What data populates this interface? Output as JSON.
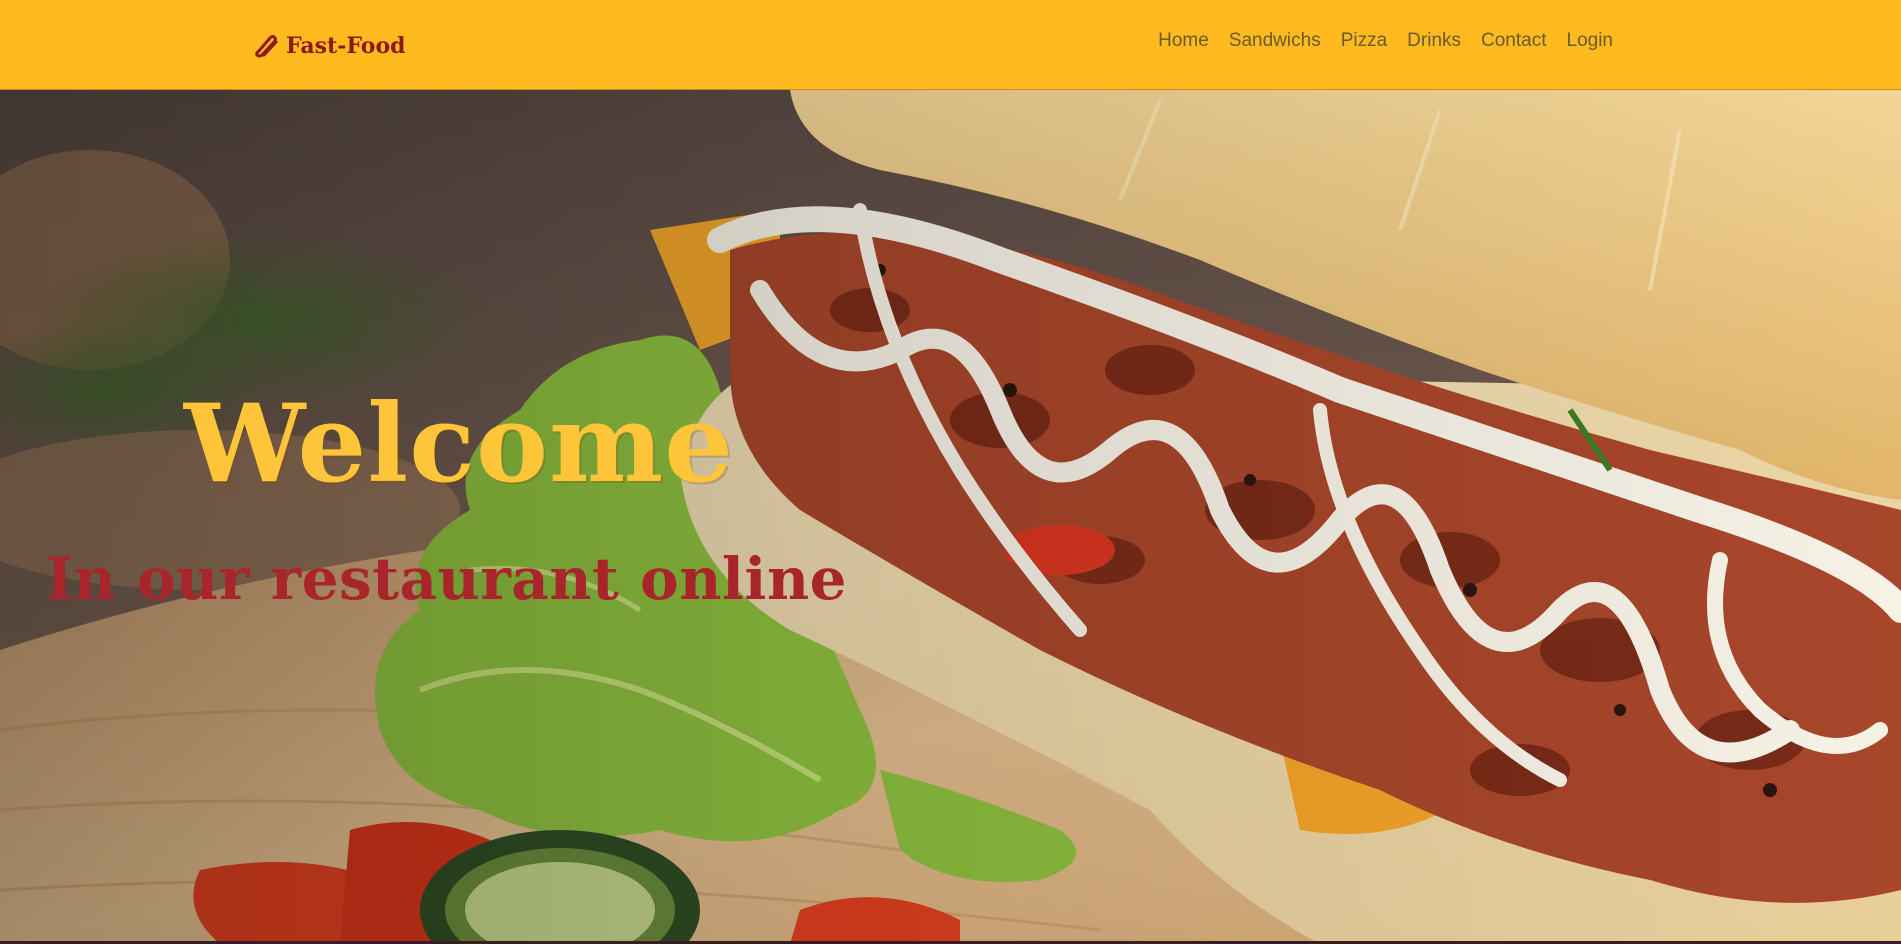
{
  "navbar": {
    "brand": {
      "icon": "hotdog-icon",
      "label": "Fast-Food"
    },
    "links": [
      {
        "label": "Home"
      },
      {
        "label": "Sandwichs"
      },
      {
        "label": "Pizza"
      },
      {
        "label": "Drinks"
      },
      {
        "label": "Contact"
      },
      {
        "label": "Login"
      }
    ]
  },
  "hero": {
    "title": "Welcome",
    "subtitle": "In our restaurant online",
    "image": "sandwich-photo"
  },
  "colors": {
    "navbar_bg": "#ffba1f",
    "brand": "#8b1a1a",
    "nav_link": "#6b5a2c",
    "hero_title": "#ffc53a",
    "hero_subtitle": "#a8262b"
  }
}
